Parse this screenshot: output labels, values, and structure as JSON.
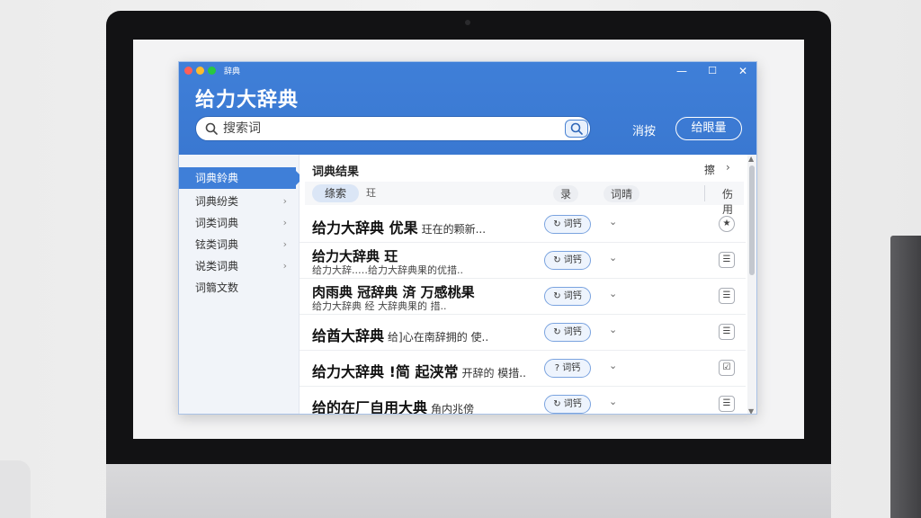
{
  "window": {
    "title": "辞典"
  },
  "window_controls": {
    "minimize": "—",
    "maximize": "☐",
    "close": "✕"
  },
  "header": {
    "app_title": "给力大辞典",
    "search_placeholder": "搜索词",
    "text_button": "消按",
    "pill_button": "给眼量"
  },
  "sidebar": {
    "items": [
      {
        "label": "词典鈴典",
        "active": true
      },
      {
        "label": "词典纷类"
      },
      {
        "label": "词类词典"
      },
      {
        "label": "铉类词典"
      },
      {
        "label": "说类词典"
      },
      {
        "label": "词篛文数"
      }
    ]
  },
  "content": {
    "title": "词典结果",
    "top_right": "擦",
    "tabs": {
      "active": "绦索",
      "second": "玨"
    },
    "columns": {
      "c1": "录",
      "c2": "词晴",
      "c3": "伤用"
    },
    "rows": [
      {
        "main": "给力大辞典 优果",
        "desc": "玨在的颗新...",
        "pill": "词钙",
        "icon": "★"
      },
      {
        "main": "给力大辞典 玨",
        "sub": "给力大辞..…给力大辞典果的优措..",
        "pill": "词钙",
        "icon": "☰"
      },
      {
        "main": "肉雨典 冠辞典 済 万感桃果",
        "sub": "给力大辞典 经 大辞典果的 措..",
        "pill": "词钙",
        "icon": "☰"
      },
      {
        "main": "给酋大辞典",
        "desc": "给]心在南辞拥的 使..",
        "pill": "词钙",
        "icon": "☰"
      },
      {
        "main": "给力大辞典 !简 起浃常",
        "desc": "开辞的 模措..",
        "pill": "词钙",
        "icon": "☑"
      },
      {
        "main": "给的在厂自用大典",
        "desc": "角内兆傍",
        "pill": "词钙",
        "icon": "☰"
      }
    ]
  },
  "colors": {
    "accent_blue": "#3f7fd8",
    "window_border": "#a9c2e6",
    "sidebar_bg": "#f1f4f9",
    "monitor_bezel": "#121214"
  }
}
